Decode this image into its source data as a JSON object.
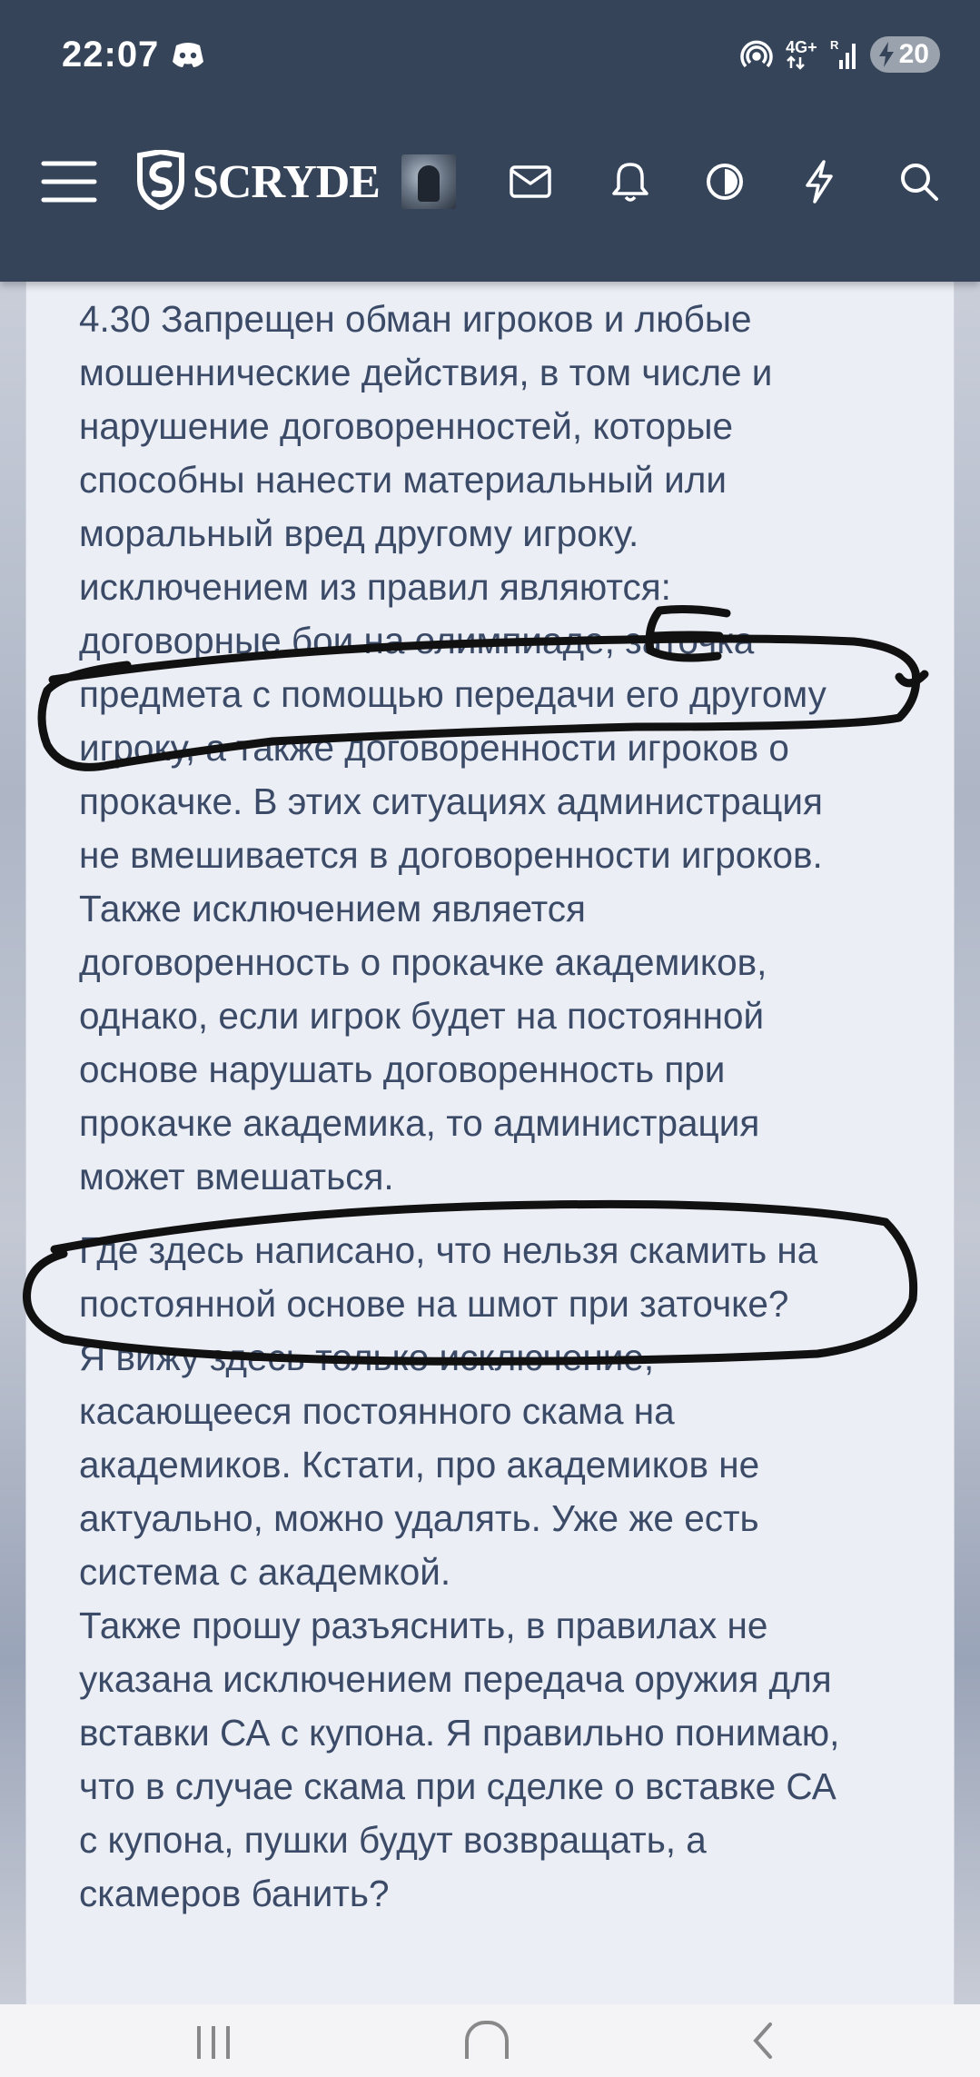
{
  "status_bar": {
    "time": "22:07",
    "network_label": "4G+",
    "battery_level": "20",
    "icons": [
      "discord-icon",
      "hotspot-icon",
      "network-4g-icon",
      "signal-icon",
      "battery-icon"
    ]
  },
  "nav": {
    "logo_text": "SCRYDE",
    "icons": [
      "menu-icon",
      "logo-shield-icon",
      "avatar",
      "mail-icon",
      "bell-icon",
      "theme-toggle-icon",
      "flash-icon",
      "search-icon"
    ]
  },
  "post": {
    "paragraph1": [
      "4.30 Запрещен обман игроков и любые",
      "мошеннические действия, в том числе и",
      "нарушение договоренностей, которые",
      "способны нанести материальный или",
      "моральный вред другому игроку.",
      "исключением из правил являются:",
      "договорные бои на олимпиаде, заточка",
      "предмета с помощью передачи его другому",
      "игроку, а также договоренности игроков о",
      "прокачке. В этих ситуациях администрация",
      "не вмешивается в договоренности игроков.",
      "Также исключением является",
      "договоренность о прокачке академиков,",
      "однако, если игрок будет на постоянной",
      "основе нарушать договоренность при",
      "прокачке академика, то администрация",
      "может вмешаться."
    ],
    "paragraph2": [
      "Где здесь написано, что нельзя скамить на",
      "постоянной основе на шмот при заточке?",
      "Я вижу здесь только исключение,",
      "касающееся постоянного скама на",
      "академиков. Кстати, про академиков не",
      "актуально, можно удалять. Уже же есть",
      "система с академкой.",
      "Также прошу разъяснить, в правилах не",
      "указана исключением передача оружия для",
      "вставки СА с купона. Я правильно понимаю,",
      "что в случае скама при сделке о вставке СА",
      "с купона, пушки будут возвращать, а",
      "скамеров банить?"
    ]
  },
  "colors": {
    "header_bg": "#36445a",
    "card_bg": "#ebeef5",
    "text": "#3b4a66",
    "ink": "#111111"
  },
  "system_nav": {
    "icons": [
      "recent-apps-icon",
      "home-icon",
      "back-icon"
    ]
  }
}
